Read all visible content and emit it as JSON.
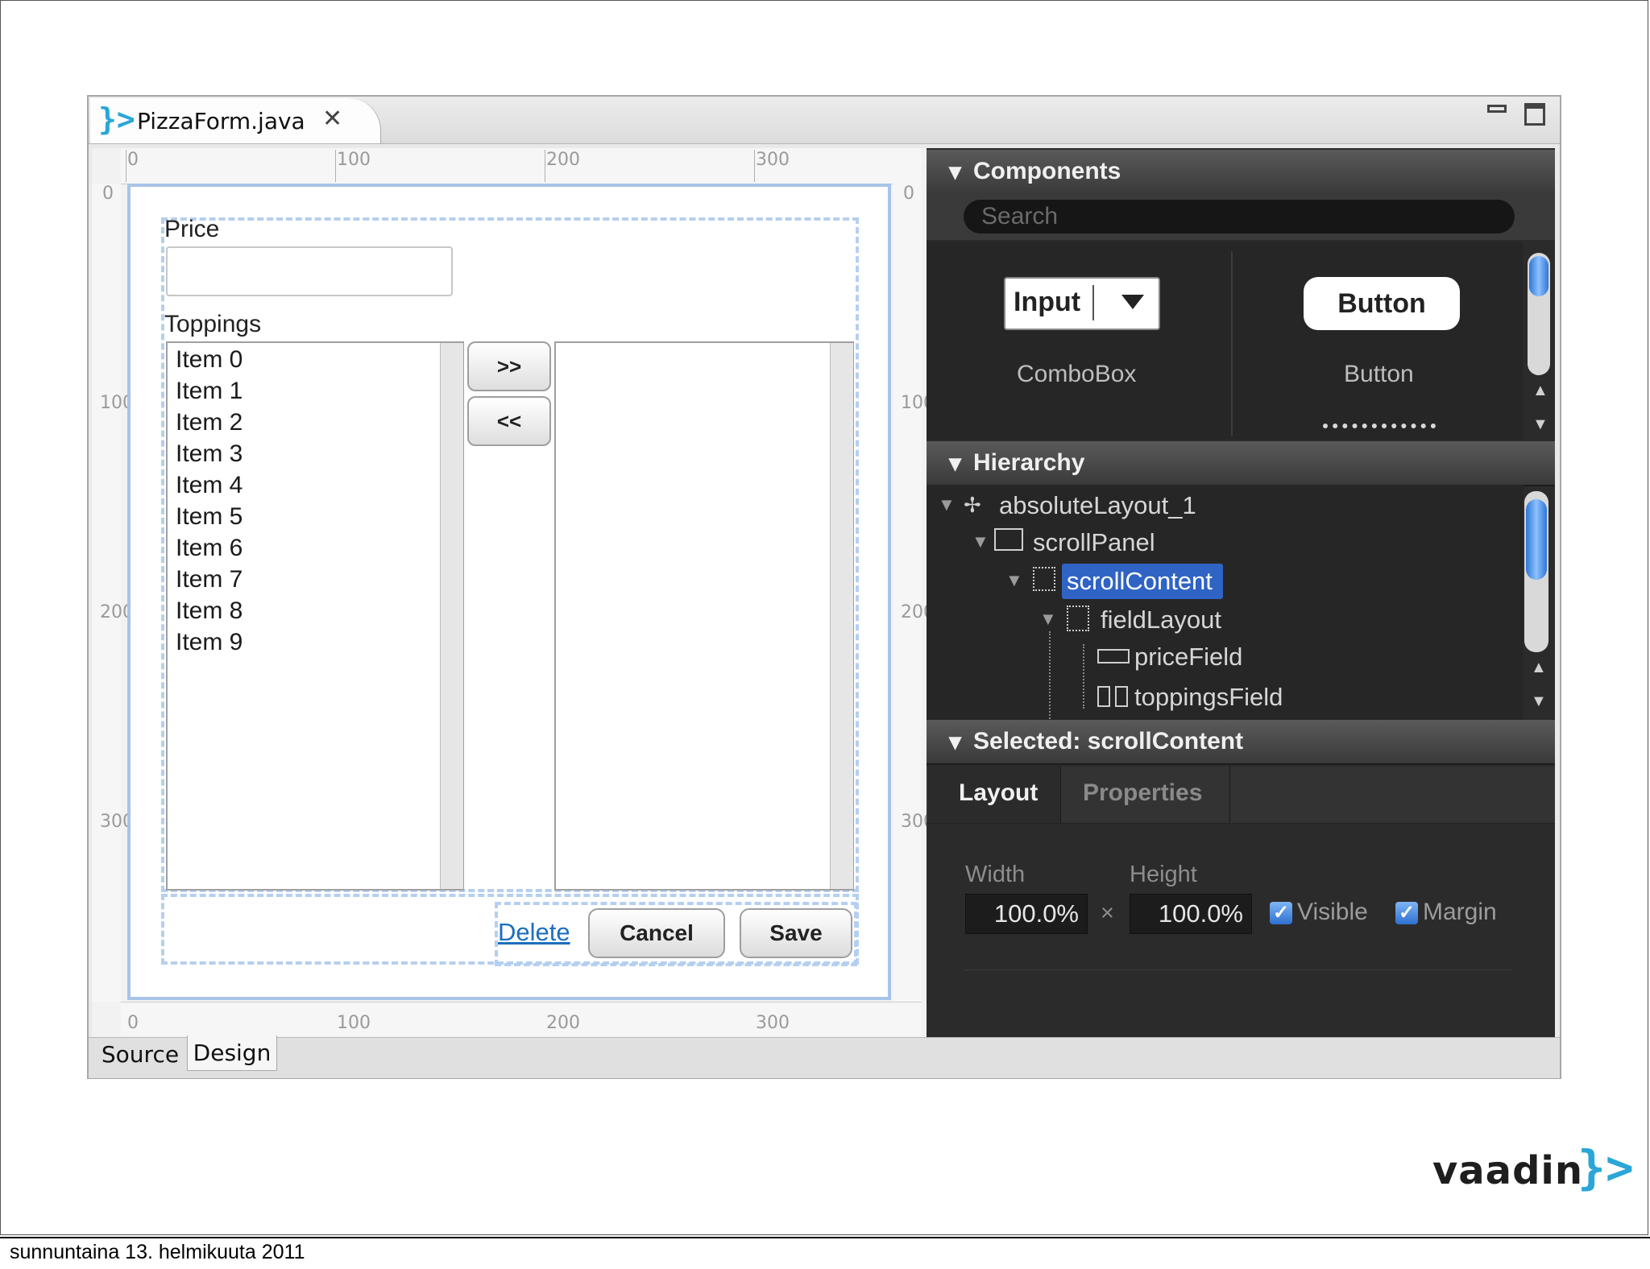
{
  "editor": {
    "file_tab": "PizzaForm.java",
    "bottom_tabs": [
      "Source",
      "Design"
    ]
  },
  "ruler": {
    "top": [
      "0",
      "100",
      "200",
      "300"
    ],
    "bottom": [
      "0",
      "100",
      "200",
      "300"
    ],
    "side": [
      "0",
      "100",
      "200",
      "300"
    ]
  },
  "form": {
    "price_label": "Price",
    "price_value": "",
    "toppings_label": "Toppings",
    "toppings_items": [
      "Item 0",
      "Item 1",
      "Item 2",
      "Item 3",
      "Item 4",
      "Item 5",
      "Item 6",
      "Item 7",
      "Item 8",
      "Item 9"
    ],
    "add_button": ">>",
    "remove_button": "<<",
    "delete_link": "Delete",
    "cancel_button": "Cancel",
    "save_button": "Save"
  },
  "palette": {
    "components_header": "Components",
    "search_placeholder": "Search",
    "combobox_preview": "Input",
    "combobox_caption": "ComboBox",
    "button_preview": "Button",
    "button_caption": "Button",
    "hierarchy_header": "Hierarchy",
    "tree": [
      {
        "label": "absoluteLayout_1"
      },
      {
        "label": "scrollPanel"
      },
      {
        "label": "scrollContent"
      },
      {
        "label": "fieldLayout"
      },
      {
        "label": "priceField"
      },
      {
        "label": "toppingsField"
      }
    ],
    "selected_header": "Selected: scrollContent",
    "tabs": [
      "Layout",
      "Properties"
    ],
    "width_label": "Width",
    "height_label": "Height",
    "width_value": "100.0%",
    "height_value": "100.0%",
    "times_sign": "×",
    "visible_label": "Visible",
    "margin_label": "Margin",
    "visible_checked": true,
    "margin_checked": true
  },
  "footer": {
    "date": "sunnuntaina 13. helmikuuta 2011",
    "logo": "vaadin",
    "logo_mark": "}>"
  }
}
